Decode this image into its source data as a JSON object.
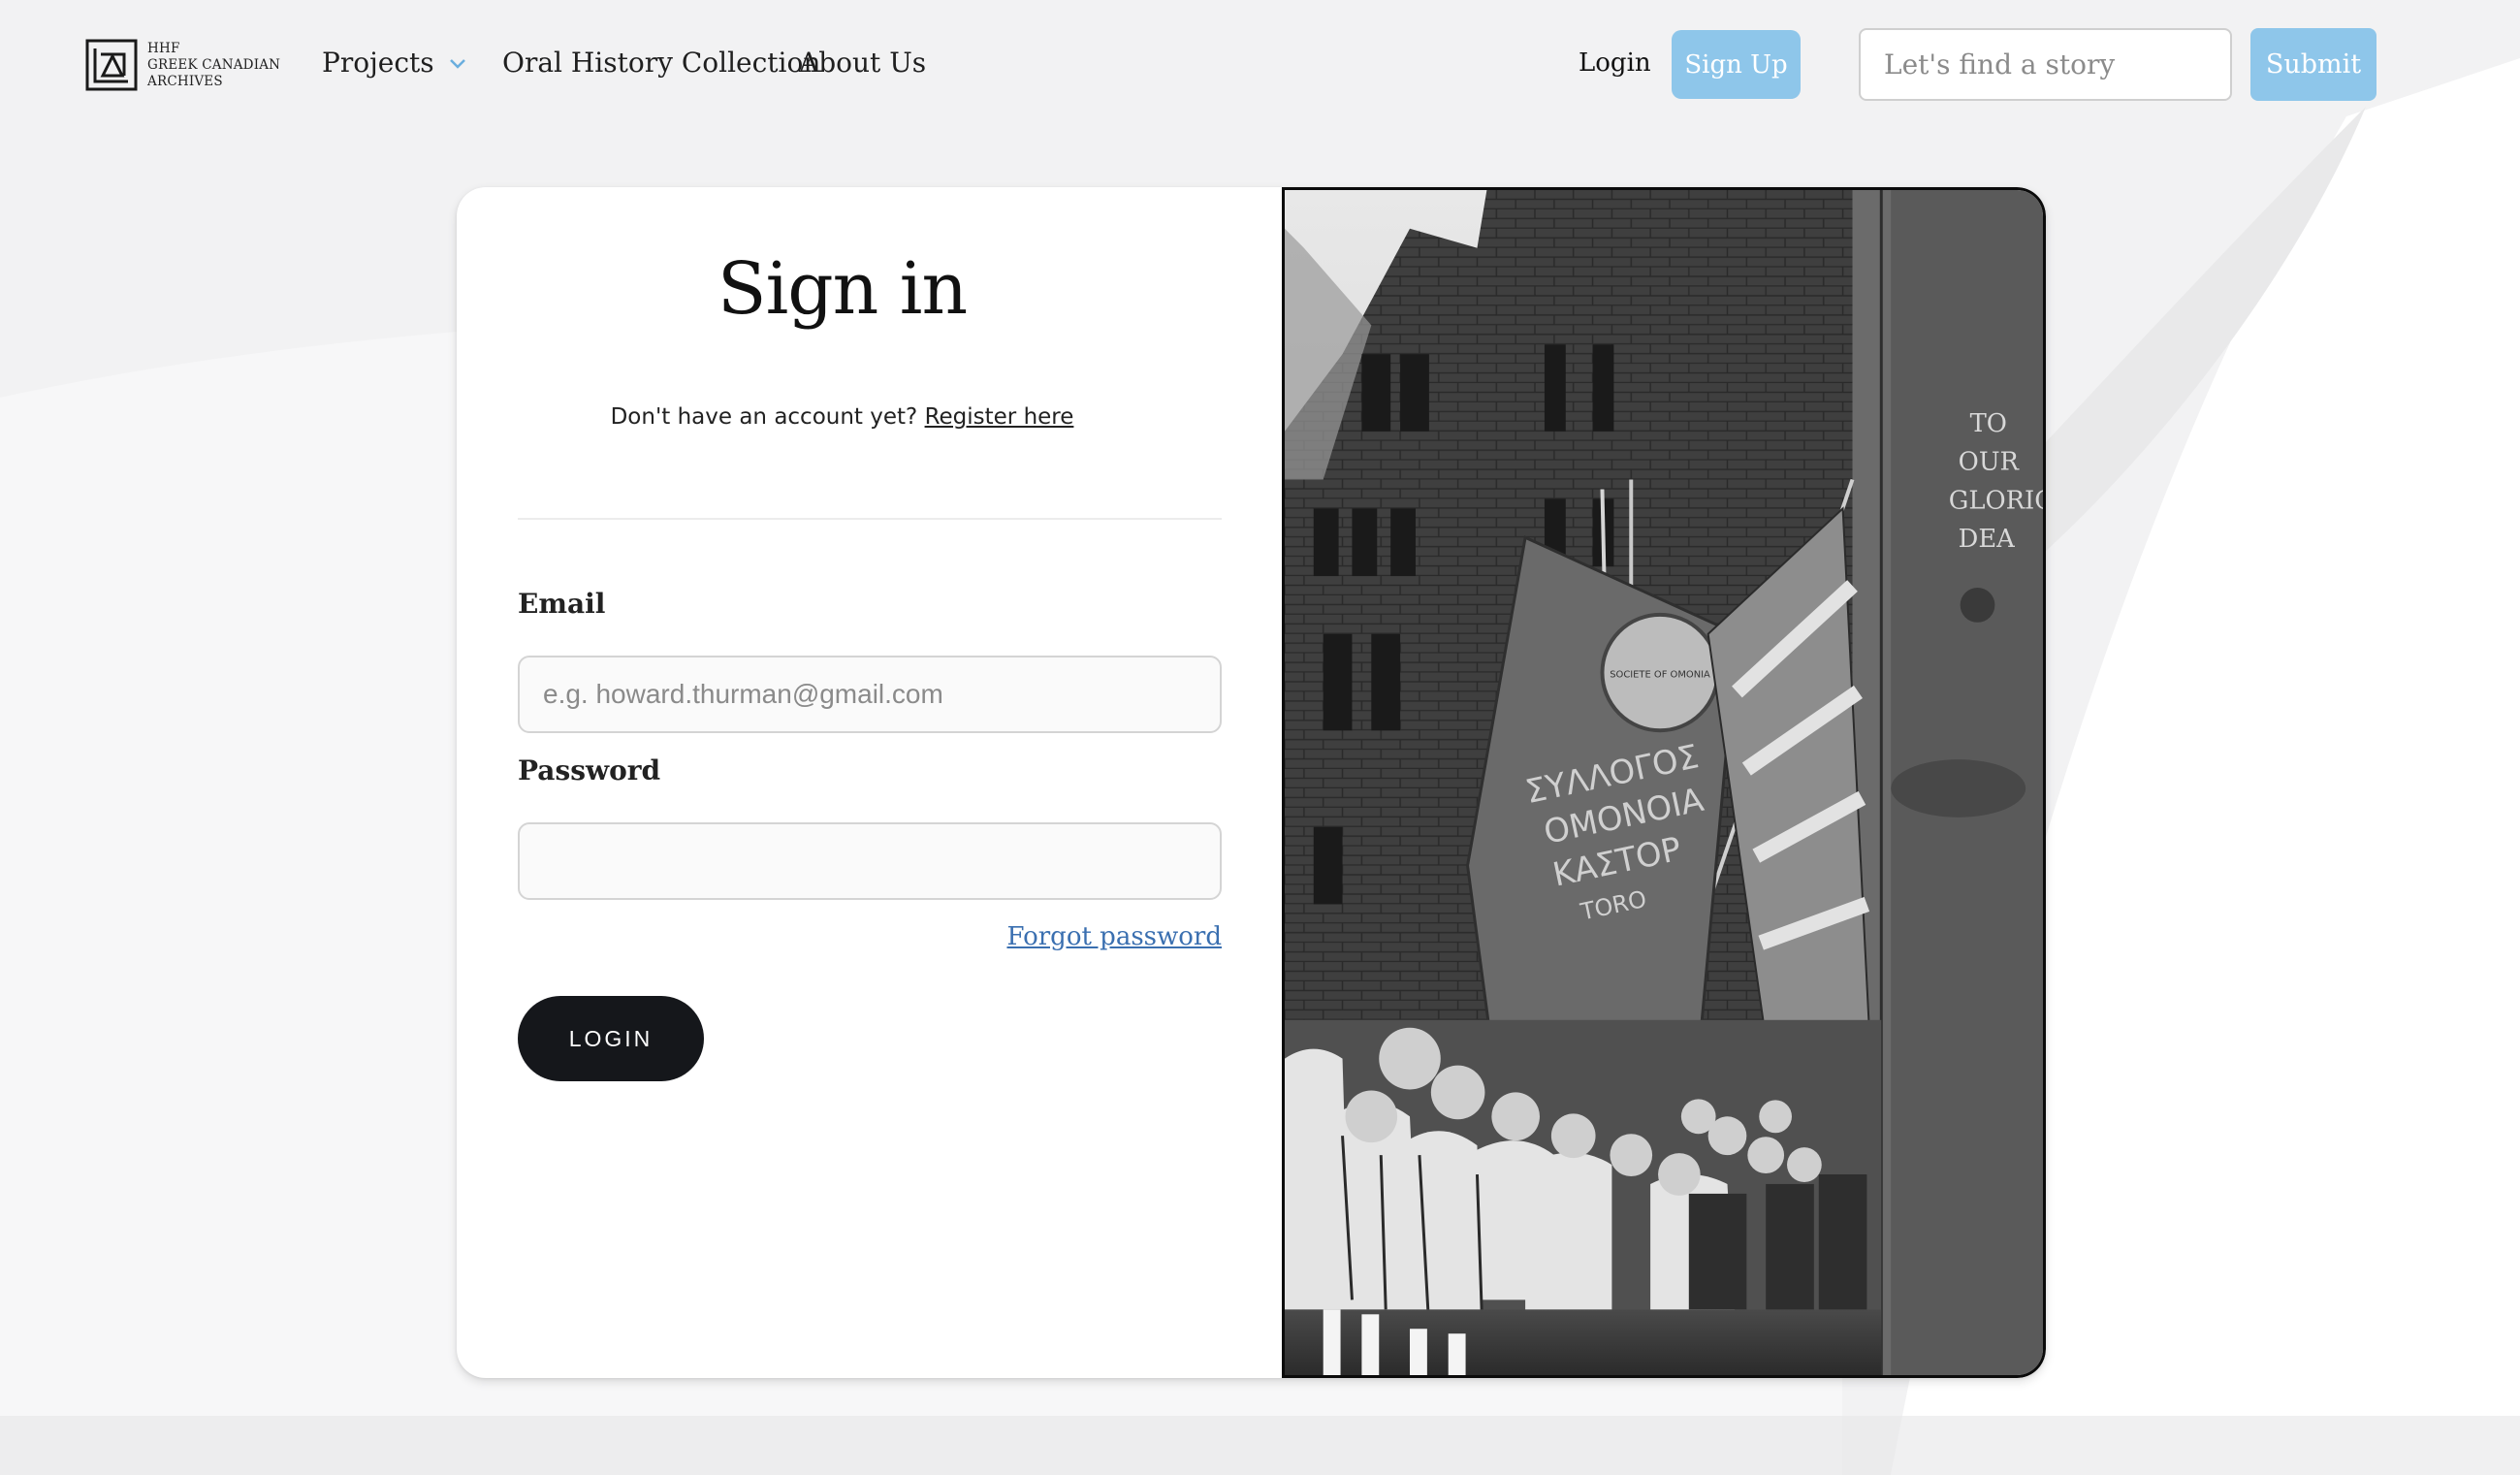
{
  "header": {
    "logo_lines": [
      "HHF",
      "GREEK CANADIAN",
      "ARCHIVES"
    ],
    "nav": {
      "projects": "Projects",
      "oral_history": "Oral History Collection",
      "about": "About Us"
    },
    "login_label": "Login",
    "signup_label": "Sign Up",
    "search": {
      "placeholder": "Let's find a story",
      "value": ""
    },
    "submit_label": "Submit"
  },
  "signin": {
    "title": "Sign in",
    "register_prompt": "Don't have an account yet?",
    "register_link": "Register here",
    "email_label": "Email",
    "email_placeholder": "e.g. howard.thurman@gmail.com",
    "password_label": "Password",
    "forgot_label": "Forgot password",
    "login_button": "LOGIN"
  },
  "photo": {
    "banner_text": [
      "ΣΥΛΛΟΓΟΣ",
      "ΟΜΟΝΟΙΑ",
      "ΚΑΣΤΟΡ",
      "TORO"
    ],
    "seal_text": "SOCIETE OF OMONIA",
    "monument_text": [
      "TO",
      "OUR",
      "GLORIO",
      "DEA"
    ]
  },
  "colors": {
    "accent": "#8ec6ea",
    "dark_button": "#15171b",
    "link": "#3a6fb0",
    "page_bg": "#f3f3f4"
  },
  "icons": {
    "logo": "hhf-logo-icon",
    "projects_dropdown": "chevron-down-icon"
  }
}
